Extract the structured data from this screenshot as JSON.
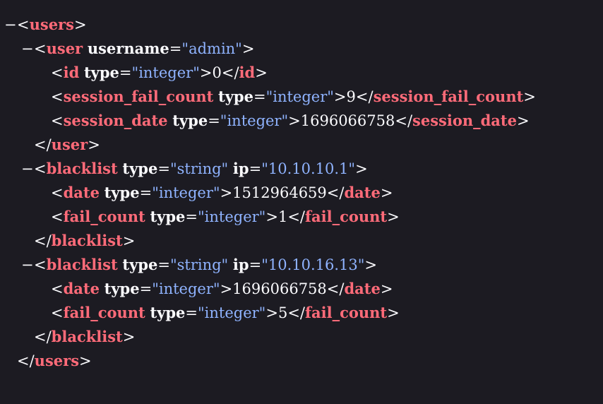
{
  "toggle_glyph": "−",
  "lines": [
    {
      "kind": "open",
      "depth": 0,
      "toggle": true,
      "tag": "users",
      "attrs": []
    },
    {
      "kind": "open",
      "depth": 1,
      "toggle": true,
      "tag": "user",
      "attrs": [
        {
          "name": "username",
          "value": "admin"
        }
      ]
    },
    {
      "kind": "leaf",
      "depth": 2,
      "tag": "id",
      "attrs": [
        {
          "name": "type",
          "value": "integer"
        }
      ],
      "text": "0"
    },
    {
      "kind": "leaf",
      "depth": 2,
      "tag": "session_fail_count",
      "attrs": [
        {
          "name": "type",
          "value": "integer"
        }
      ],
      "text": "9"
    },
    {
      "kind": "leaf",
      "depth": 2,
      "tag": "session_date",
      "attrs": [
        {
          "name": "type",
          "value": "integer"
        }
      ],
      "text": "1696066758"
    },
    {
      "kind": "close",
      "depth": 1,
      "tag": "user"
    },
    {
      "kind": "open",
      "depth": 1,
      "toggle": true,
      "tag": "blacklist",
      "attrs": [
        {
          "name": "type",
          "value": "string"
        },
        {
          "name": "ip",
          "value": "10.10.10.1"
        }
      ]
    },
    {
      "kind": "leaf",
      "depth": 2,
      "tag": "date",
      "attrs": [
        {
          "name": "type",
          "value": "integer"
        }
      ],
      "text": "1512964659"
    },
    {
      "kind": "leaf",
      "depth": 2,
      "tag": "fail_count",
      "attrs": [
        {
          "name": "type",
          "value": "integer"
        }
      ],
      "text": "1"
    },
    {
      "kind": "close",
      "depth": 1,
      "tag": "blacklist"
    },
    {
      "kind": "open",
      "depth": 1,
      "toggle": true,
      "tag": "blacklist",
      "attrs": [
        {
          "name": "type",
          "value": "string"
        },
        {
          "name": "ip",
          "value": "10.10.16.13"
        }
      ]
    },
    {
      "kind": "leaf",
      "depth": 2,
      "tag": "date",
      "attrs": [
        {
          "name": "type",
          "value": "integer"
        }
      ],
      "text": "1696066758"
    },
    {
      "kind": "leaf",
      "depth": 2,
      "tag": "fail_count",
      "attrs": [
        {
          "name": "type",
          "value": "integer"
        }
      ],
      "text": "5"
    },
    {
      "kind": "close",
      "depth": 1,
      "tag": "blacklist"
    },
    {
      "kind": "close",
      "depth": 0,
      "tag": "users"
    }
  ]
}
